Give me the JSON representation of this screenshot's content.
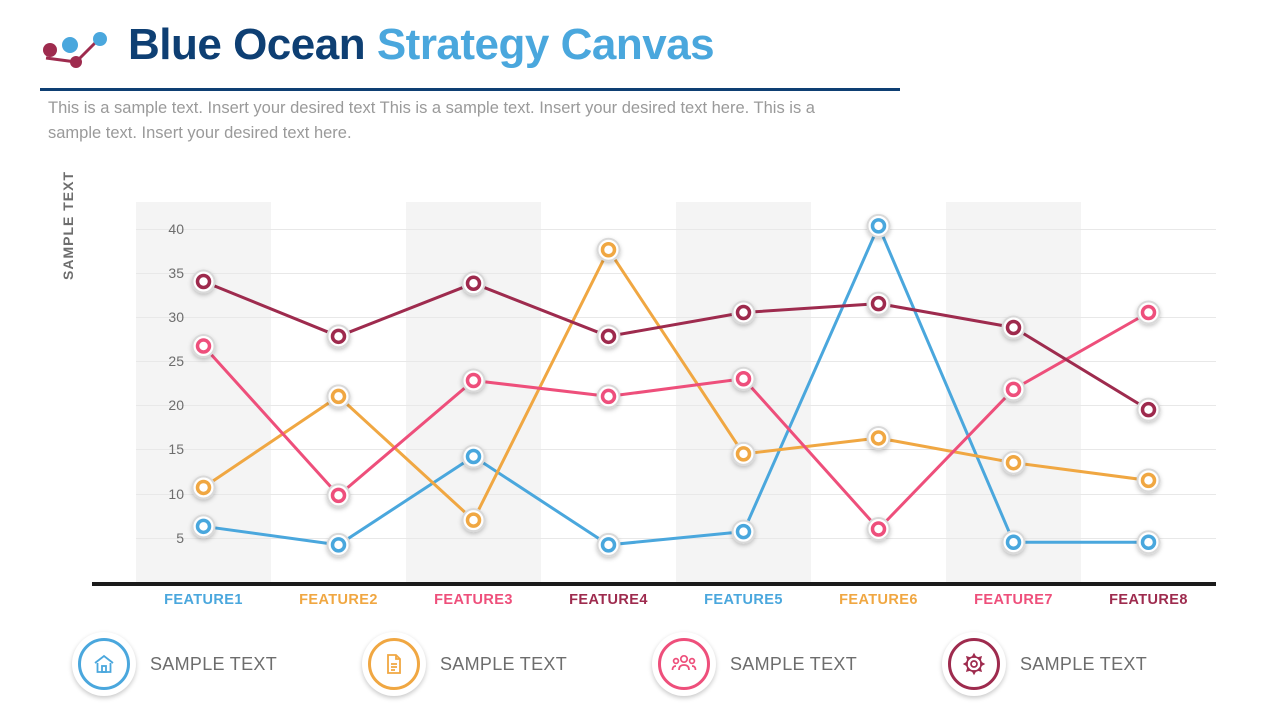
{
  "header": {
    "title_part1": "Blue Ocean ",
    "title_part2": "Strategy Canvas",
    "subtitle": "This is a sample text. Insert your desired text This is a sample text. Insert your desired text here. This is a sample text. Insert your desired text here."
  },
  "colors": {
    "blue": "#4aa7dd",
    "orange": "#f0a742",
    "pink": "#ee4f7b",
    "maroon": "#9e2b4e",
    "title_dark": "#0e3f73",
    "band": "#f4f4f4",
    "axis": "#1b1b1b",
    "text_gray": "#6d6d6d"
  },
  "legend": [
    {
      "label": "SAMPLE TEXT",
      "icon": "home-icon",
      "color": "#4aa7dd"
    },
    {
      "label": "SAMPLE TEXT",
      "icon": "document-icon",
      "color": "#f0a742"
    },
    {
      "label": "SAMPLE TEXT",
      "icon": "people-icon",
      "color": "#ee4f7b"
    },
    {
      "label": "SAMPLE TEXT",
      "icon": "gear-icon",
      "color": "#9e2b4e"
    }
  ],
  "chart_data": {
    "type": "line",
    "title": "",
    "xlabel": "",
    "ylabel": "SAMPLE TEXT",
    "categories": [
      "FEATURE1",
      "FEATURE2",
      "FEATURE3",
      "FEATURE4",
      "FEATURE5",
      "FEATURE6",
      "FEATURE7",
      "FEATURE8"
    ],
    "category_colors": [
      "#4aa7dd",
      "#f0a742",
      "#ee4f7b",
      "#9e2b4e",
      "#4aa7dd",
      "#f0a742",
      "#ee4f7b",
      "#9e2b4e"
    ],
    "yticks": [
      5,
      10,
      15,
      20,
      25,
      30,
      35,
      40
    ],
    "ylim": [
      0,
      43
    ],
    "grid": true,
    "legend_position": "bottom",
    "series": [
      {
        "name": "SAMPLE TEXT",
        "color": "#4aa7dd",
        "values": [
          6.3,
          4.2,
          14.2,
          4.2,
          5.7,
          40.3,
          4.5,
          4.5
        ]
      },
      {
        "name": "SAMPLE TEXT",
        "color": "#f0a742",
        "values": [
          10.7,
          21.0,
          7.0,
          37.6,
          14.5,
          16.3,
          13.5,
          11.5
        ]
      },
      {
        "name": "SAMPLE TEXT",
        "color": "#ee4f7b",
        "values": [
          26.7,
          9.8,
          22.8,
          21.0,
          23.0,
          6.0,
          21.8,
          30.5
        ]
      },
      {
        "name": "SAMPLE TEXT",
        "color": "#9e2b4e",
        "values": [
          34.0,
          27.8,
          33.8,
          27.8,
          30.5,
          31.5,
          28.8,
          19.5
        ]
      }
    ]
  }
}
